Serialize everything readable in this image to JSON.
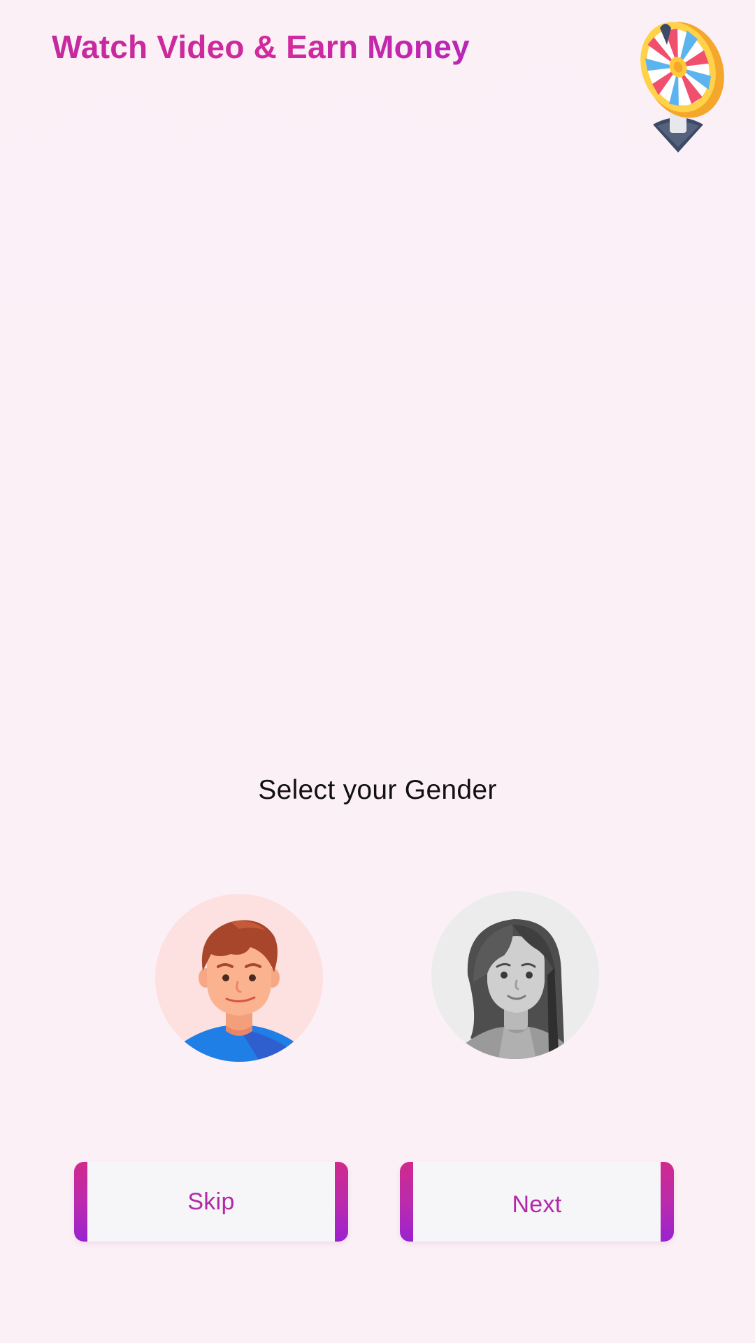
{
  "header": {
    "title": "Watch Video & Earn Money",
    "spin_wheel_icon": "spin-wheel-icon"
  },
  "gender_selection": {
    "title": "Select your Gender",
    "options": [
      {
        "value": "male",
        "icon": "male-avatar-icon",
        "selected": true
      },
      {
        "value": "female",
        "icon": "female-avatar-icon",
        "selected": false
      }
    ]
  },
  "actions": {
    "skip_label": "Skip",
    "next_label": "Next"
  },
  "colors": {
    "background": "#fcf0f7",
    "accent_gradient_start": "#d02a8c",
    "accent_gradient_end": "#9a22d0",
    "button_text": "#b22aa8"
  }
}
